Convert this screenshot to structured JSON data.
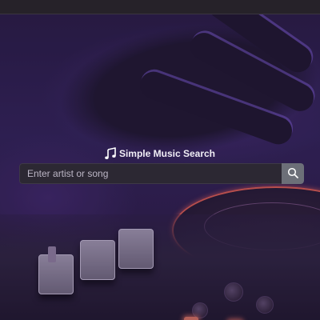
{
  "app": {
    "title": "Simple Music Search"
  },
  "search": {
    "placeholder": "Enter artist or song",
    "value": ""
  },
  "icons": {
    "title_icon": "music-note-icon",
    "search_button_icon": "search-icon"
  },
  "colors": {
    "background_tint": "#2d2050",
    "input_background": "#2c2833",
    "button_background": "#6c6f78",
    "title_text": "#f0eef5"
  }
}
